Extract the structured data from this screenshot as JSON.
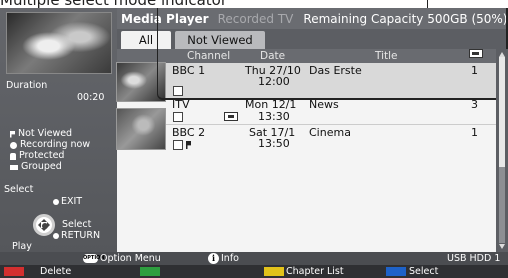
{
  "annotation_cut_text": "Multiple select mode indicator",
  "header": {
    "title": "Media Player",
    "section": "Recorded TV",
    "capacity": "Remaining Capacity 500GB (50%)"
  },
  "tabs": [
    {
      "label": "All"
    },
    {
      "label": "Not Viewed"
    }
  ],
  "columns": {
    "channel": "Channel",
    "date": "Date",
    "title": "Title"
  },
  "rows": [
    {
      "channel": "BBC 1",
      "date1": "Thu 27/10",
      "date2": "12:00",
      "title": "Das Erste",
      "count": "1",
      "selected": true
    },
    {
      "channel": "ITV",
      "date1": "Mon 12/1",
      "date2": "",
      "title": "News",
      "count": "3"
    },
    {
      "channel": "",
      "date1": "13:30",
      "date2": "",
      "title": "",
      "count": ""
    },
    {
      "channel": "BBC 2",
      "date1": "Sat 17/1",
      "date2": "13:50",
      "title": "Cinema",
      "count": "1"
    }
  ],
  "left_panel": {
    "duration_label": "Duration",
    "duration_value": "00:20",
    "legend": [
      {
        "label": "Not Viewed",
        "icon": "flag-icon"
      },
      {
        "label": "Recording now",
        "icon": "recording-dot-icon"
      },
      {
        "label": "Protected",
        "icon": "lock-icon"
      },
      {
        "label": "Grouped",
        "icon": "group-icon"
      }
    ],
    "select_label": "Select",
    "exit_label": "EXIT",
    "select_center_label": "Select",
    "return_label": "RETURN",
    "play_label": "Play"
  },
  "infobar": {
    "option_badge": "OPTION",
    "option_label": "Option Menu",
    "info_badge": "i",
    "info_label": "Info",
    "device": "USB HDD 1"
  },
  "keybar": {
    "red": "Delete",
    "green": "",
    "yellow": "Chapter List",
    "blue": "Select"
  },
  "colors": {
    "red_key": "#d32f2f",
    "green_key": "#2e9e3f",
    "yellow_key": "#e2c21a",
    "blue_key": "#1e62c8"
  }
}
